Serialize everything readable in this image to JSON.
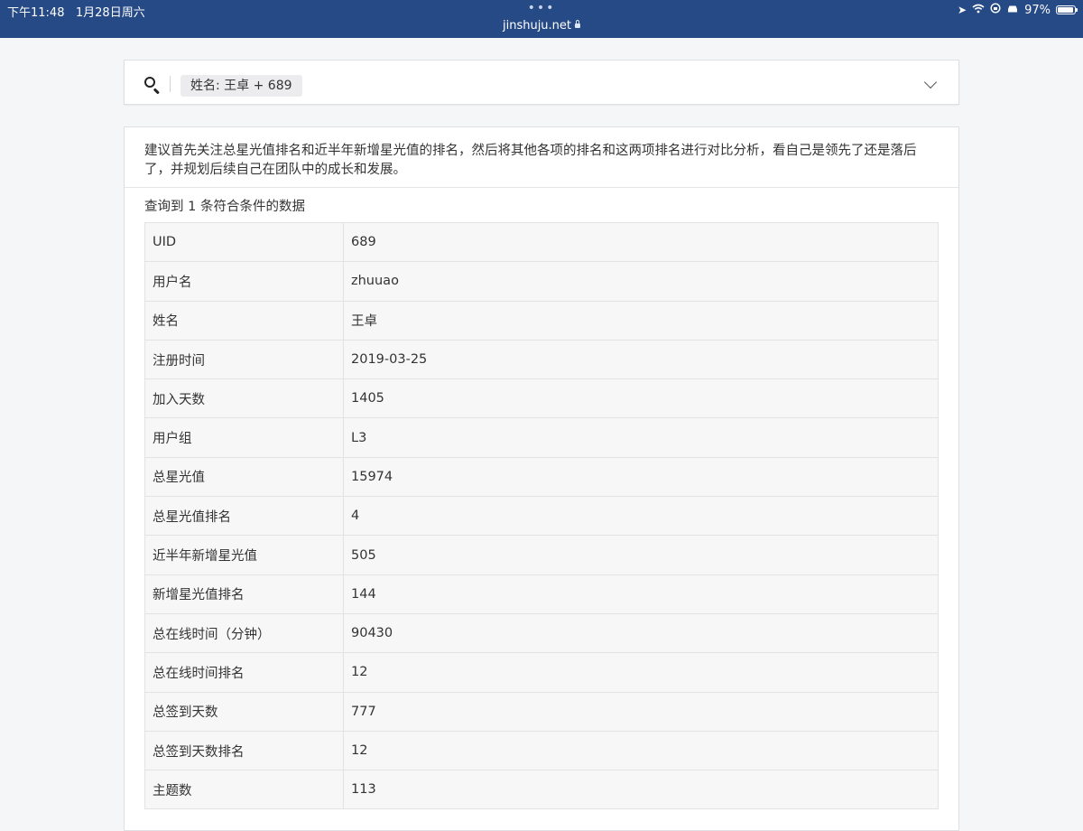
{
  "status_bar": {
    "time": "下午11:48",
    "date": "1月28日周六",
    "dots": "•••",
    "url": "jinshuju.net",
    "battery_percent": "97%",
    "battery_level": 0.97,
    "icons": [
      "location-icon",
      "wifi-icon",
      "orientation-lock-icon",
      "car-icon",
      "battery-icon"
    ]
  },
  "search": {
    "filter_tag": "姓名: 王卓 + 689"
  },
  "result": {
    "advice": "建议首先关注总星光值排名和近半年新增星光值的排名，然后将其他各项的排名和这两项排名进行对比分析，看自己是领先了还是落后了，并规划后续自己在团队中的成长和发展。",
    "count_text": "查询到 1 条符合条件的数据",
    "rows": [
      {
        "label": "UID",
        "value": "689"
      },
      {
        "label": "用户名",
        "value": "zhuuao"
      },
      {
        "label": "姓名",
        "value": "王卓"
      },
      {
        "label": "注册时间",
        "value": "2019-03-25"
      },
      {
        "label": "加入天数",
        "value": "1405"
      },
      {
        "label": "用户组",
        "value": "L3"
      },
      {
        "label": "总星光值",
        "value": "15974"
      },
      {
        "label": "总星光值排名",
        "value": "4"
      },
      {
        "label": "近半年新增星光值",
        "value": "505"
      },
      {
        "label": "新增星光值排名",
        "value": "144"
      },
      {
        "label": "总在线时间（分钟）",
        "value": "90430"
      },
      {
        "label": "总在线时间排名",
        "value": "12"
      },
      {
        "label": "总签到天数",
        "value": "777"
      },
      {
        "label": "总签到天数排名",
        "value": "12"
      },
      {
        "label": "主题数",
        "value": "113"
      }
    ]
  }
}
